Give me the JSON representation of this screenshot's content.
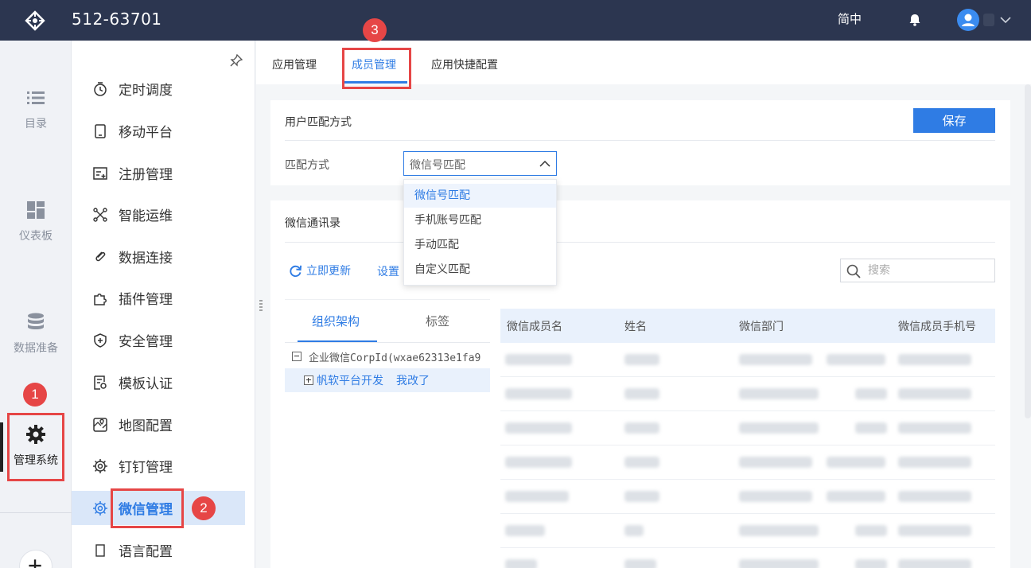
{
  "header": {
    "app_title": "512-63701",
    "language": "简中"
  },
  "rail": {
    "items": [
      {
        "label": "目录"
      },
      {
        "label": "仪表板"
      },
      {
        "label": "数据准备"
      },
      {
        "label": "管理系统"
      }
    ]
  },
  "submenu": {
    "items": [
      {
        "label": "定时调度",
        "icon": "clock-icon"
      },
      {
        "label": "移动平台",
        "icon": "mobile-icon"
      },
      {
        "label": "注册管理",
        "icon": "register-icon"
      },
      {
        "label": "智能运维",
        "icon": "ops-icon"
      },
      {
        "label": "数据连接",
        "icon": "link-icon"
      },
      {
        "label": "插件管理",
        "icon": "plugin-icon"
      },
      {
        "label": "安全管理",
        "icon": "shield-icon"
      },
      {
        "label": "模板认证",
        "icon": "template-icon"
      },
      {
        "label": "地图配置",
        "icon": "map-icon"
      },
      {
        "label": "钉钉管理",
        "icon": "gear-icon"
      },
      {
        "label": "微信管理",
        "icon": "gear-icon"
      },
      {
        "label": "语言配置",
        "icon": "language-icon"
      }
    ],
    "active_index": 10
  },
  "tabs": [
    {
      "label": "应用管理"
    },
    {
      "label": "成员管理"
    },
    {
      "label": "应用快捷配置"
    }
  ],
  "match_card": {
    "title": "用户匹配方式",
    "save_label": "保存",
    "field_label": "匹配方式",
    "selected_value": "微信号匹配",
    "options": [
      "微信号匹配",
      "手机账号匹配",
      "手动匹配",
      "自定义匹配"
    ]
  },
  "contacts_card": {
    "title": "微信通讯录",
    "refresh_label": "立即更新",
    "settings_label": "设置",
    "search_placeholder": "搜索",
    "tree_tabs": [
      "组织架构",
      "标签"
    ],
    "tree_root": "企业微信CorpId(wxae62313e1fa9",
    "tree_child": "帆软平台开发",
    "tree_child_extra": "我改了",
    "columns": [
      "微信成员名",
      "姓名",
      "微信部门",
      "微信成员手机号"
    ]
  },
  "annotations": {
    "badges": [
      "1",
      "2",
      "3"
    ]
  },
  "colors": {
    "topbar": "#2c3650",
    "accent": "#2f7ce4",
    "annotation": "#e64646"
  }
}
